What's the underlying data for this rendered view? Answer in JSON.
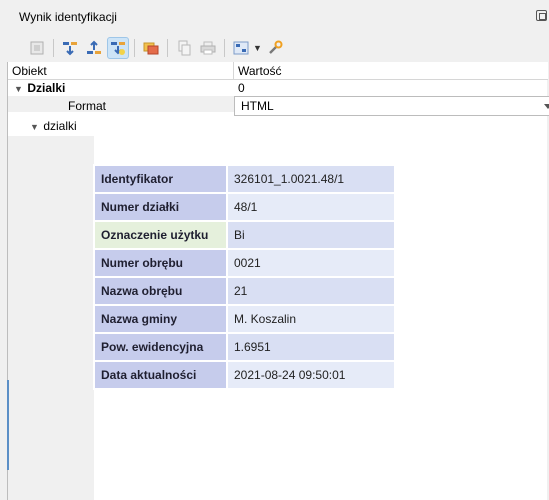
{
  "panel": {
    "title": "Wynik identyfikacji"
  },
  "toolbar": {
    "buttons": [
      {
        "name": "expand-all",
        "icon": "expand-icon",
        "active": false
      },
      {
        "name": "expand",
        "icon": "expand-tree-icon",
        "active": false
      },
      {
        "name": "collapse",
        "icon": "collapse-tree-icon",
        "active": false
      },
      {
        "name": "select",
        "icon": "select-feature-icon",
        "active": true
      },
      {
        "name": "layer",
        "icon": "layer-icon",
        "active": false
      },
      {
        "name": "copy",
        "icon": "copy-icon",
        "active": false
      },
      {
        "name": "print",
        "icon": "print-icon",
        "active": false
      },
      {
        "name": "identify-mode",
        "icon": "identify-mode-icon",
        "active": false
      },
      {
        "name": "settings",
        "icon": "wrench-icon",
        "active": false
      }
    ]
  },
  "tree": {
    "col_object": "Obiekt",
    "col_value": "Wartość",
    "layer_name": "Dzialki",
    "layer_count": "0",
    "format_label": "Format",
    "format_value": "HTML",
    "feature_name": "dzialki"
  },
  "identify_table": {
    "rows": [
      {
        "key": "Identyfikator",
        "value": "326101_1.0021.48/1"
      },
      {
        "key": "Numer działki",
        "value": "48/1"
      },
      {
        "key": "Oznaczenie użytku",
        "value": "Bi"
      },
      {
        "key": "Numer obrębu",
        "value": "0021"
      },
      {
        "key": "Nazwa obrębu",
        "value": "21"
      },
      {
        "key": "Nazwa gminy",
        "value": "M. Koszalin"
      },
      {
        "key": "Pow. ewidencyjna",
        "value": "1.6951"
      },
      {
        "key": "Data aktualności",
        "value": "2021-08-24 09:50:01"
      }
    ]
  }
}
